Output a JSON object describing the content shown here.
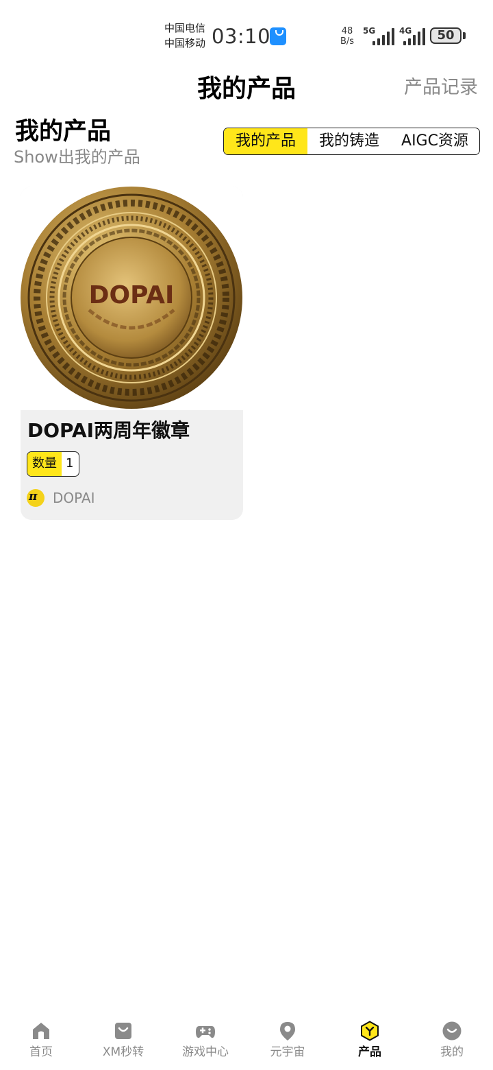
{
  "status_bar": {
    "carrier_1": "中国电信",
    "carrier_2": "中国移动",
    "time": "03:10",
    "net_speed_value": "48",
    "net_speed_unit": "B/s",
    "signal_1_label": "5G",
    "signal_2_label": "4G",
    "battery": "50"
  },
  "header": {
    "title": "我的产品",
    "record_link": "产品记录"
  },
  "section": {
    "title": "我的产品",
    "subtitle": "Show出我的产品"
  },
  "tabs": [
    {
      "label": "我的产品",
      "active": true
    },
    {
      "label": "我的铸造",
      "active": false
    },
    {
      "label": "AIGC资源",
      "active": false
    }
  ],
  "products": [
    {
      "name": "DOPAI两周年徽章",
      "coin_text": "DOPAI",
      "qty_label": "数量",
      "qty_value": "1",
      "creator": "DOPAI",
      "creator_avatar_icon": "dopai-logo-icon"
    }
  ],
  "colors": {
    "accent": "#ffe61a",
    "muted_text": "#8a8a8a",
    "card_bg": "#f0f0f0",
    "coin_gold": "#b8923a"
  },
  "bottom_nav": [
    {
      "label": "首页",
      "icon": "home-icon",
      "active": false
    },
    {
      "label": "XM秒转",
      "icon": "shopping-bag-icon",
      "active": false
    },
    {
      "label": "游戏中心",
      "icon": "gamepad-icon",
      "active": false
    },
    {
      "label": "元宇宙",
      "icon": "location-pin-icon",
      "active": false
    },
    {
      "label": "产品",
      "icon": "hexagon-product-icon",
      "active": true
    },
    {
      "label": "我的",
      "icon": "profile-smile-icon",
      "active": false
    }
  ]
}
